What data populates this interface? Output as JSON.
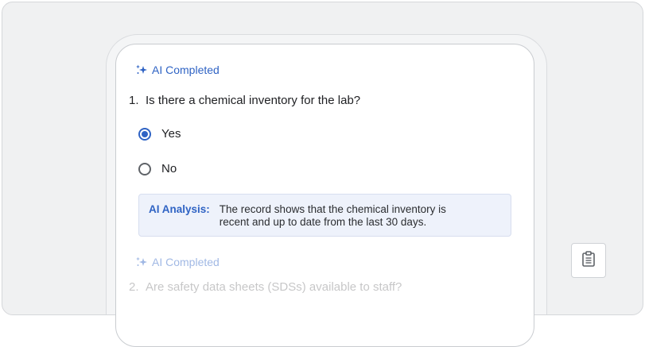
{
  "ai_status_label": "AI Completed",
  "questions": [
    {
      "number": "1.",
      "text": "Is there a chemical inventory for the lab?",
      "options": [
        {
          "label": "Yes",
          "selected": true
        },
        {
          "label": "No",
          "selected": false
        }
      ],
      "analysis": {
        "label": "AI Analysis:",
        "text": "The record shows that the chemical inventory is recent and up to date from the last 30 days."
      }
    },
    {
      "number": "2.",
      "text": "Are safety data sheets (SDSs) available to staff?"
    }
  ],
  "icons": {
    "ai": "sparkle-icon",
    "side_button": "clipboard-icon"
  },
  "colors": {
    "accent": "#2f63c4",
    "analysis_background": "#eef2fb",
    "frame_background": "#f0f1f2"
  }
}
